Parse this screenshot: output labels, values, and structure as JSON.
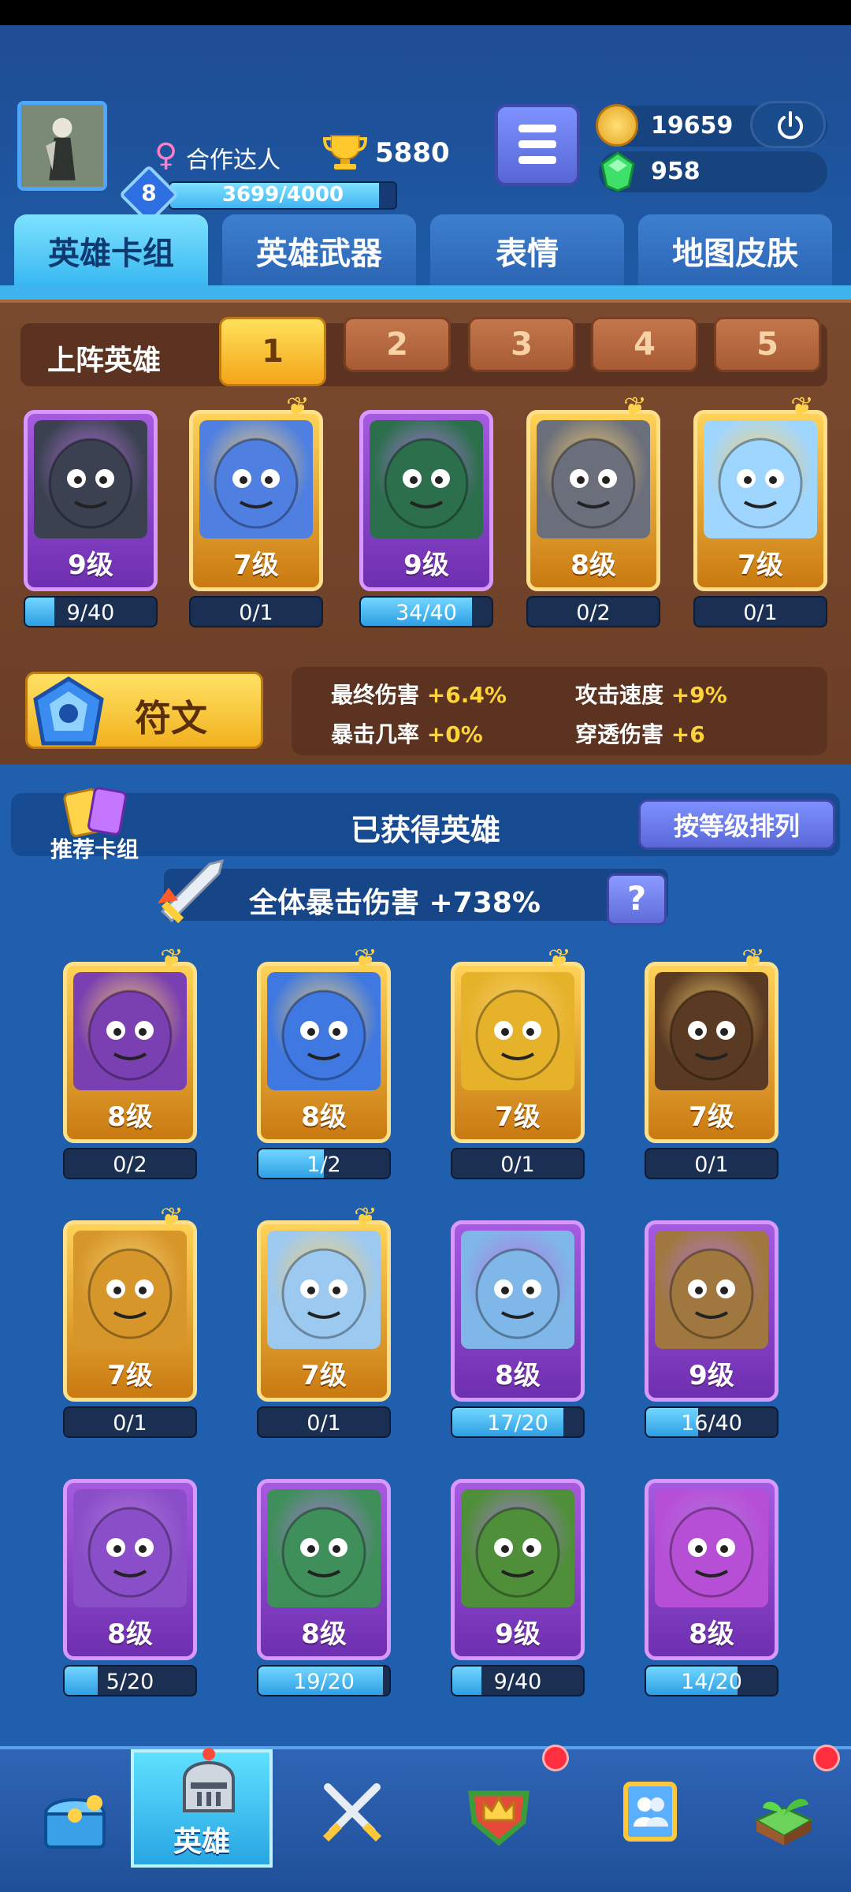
{
  "header": {
    "player_name": "合作达人",
    "trophies": "5880",
    "level": "8",
    "xp_text": "3699/4000",
    "xp_fraction": 0.925,
    "coins": "19659",
    "gems": "958"
  },
  "tabs": [
    {
      "label": "英雄卡组",
      "active": true
    },
    {
      "label": "英雄武器",
      "active": false
    },
    {
      "label": "表情",
      "active": false
    },
    {
      "label": "地图皮肤",
      "active": false
    }
  ],
  "lineup": {
    "title": "上阵英雄",
    "slots": [
      "1",
      "2",
      "3",
      "4",
      "5"
    ],
    "active_slot": 1,
    "heroes": [
      {
        "level": "9级",
        "progress": "9/40",
        "fill": 0.225,
        "frame": "purple",
        "art": "#3b4150"
      },
      {
        "level": "7级",
        "progress": "0/1",
        "fill": 0,
        "frame": "gold",
        "art": "#4f7fe0"
      },
      {
        "level": "9级",
        "progress": "34/40",
        "fill": 0.85,
        "frame": "purple",
        "art": "#2b6f4c"
      },
      {
        "level": "8级",
        "progress": "0/2",
        "fill": 0,
        "frame": "gold",
        "art": "#6b6f7c"
      },
      {
        "level": "7级",
        "progress": "0/1",
        "fill": 0,
        "frame": "gold",
        "art": "#9fd6ff"
      }
    ]
  },
  "rune": {
    "label": "符文",
    "stats": [
      {
        "name": "最终伤害",
        "value": "+6.4%"
      },
      {
        "name": "攻击速度",
        "value": "+9%"
      },
      {
        "name": "暴击几率",
        "value": "+0%"
      },
      {
        "name": "穿透伤害",
        "value": "+6"
      }
    ]
  },
  "collection": {
    "recommend_label": "推荐卡组",
    "title": "已获得英雄",
    "sort_label": "按等级排列",
    "crit_text": "全体暴击伤害 +738%",
    "help_label": "?",
    "heroes": [
      {
        "level": "8级",
        "progress": "0/2",
        "fill": 0,
        "frame": "gold",
        "art": "#7a3fb0"
      },
      {
        "level": "8级",
        "progress": "1/2",
        "fill": 0.5,
        "frame": "gold",
        "art": "#3f78e0"
      },
      {
        "level": "7级",
        "progress": "0/1",
        "fill": 0,
        "frame": "gold",
        "art": "#e6b22a"
      },
      {
        "level": "7级",
        "progress": "0/1",
        "fill": 0,
        "frame": "gold",
        "art": "#5a3a22"
      },
      {
        "level": "7级",
        "progress": "0/1",
        "fill": 0,
        "frame": "gold",
        "art": "#d6962a"
      },
      {
        "level": "7级",
        "progress": "0/1",
        "fill": 0,
        "frame": "gold",
        "art": "#9cc9f0"
      },
      {
        "level": "8级",
        "progress": "17/20",
        "fill": 0.85,
        "frame": "purple",
        "art": "#7fb7e8"
      },
      {
        "level": "9级",
        "progress": "16/40",
        "fill": 0.4,
        "frame": "purple",
        "art": "#a0783f"
      },
      {
        "level": "8级",
        "progress": "5/20",
        "fill": 0.25,
        "frame": "purple",
        "art": "#8a4fc8"
      },
      {
        "level": "8级",
        "progress": "19/20",
        "fill": 0.95,
        "frame": "purple",
        "art": "#3f8f5a"
      },
      {
        "level": "9级",
        "progress": "9/40",
        "fill": 0.225,
        "frame": "purple",
        "art": "#4f8f3a"
      },
      {
        "level": "8级",
        "progress": "14/20",
        "fill": 0.7,
        "frame": "purple",
        "art": "#b74fd6"
      }
    ]
  },
  "bottom_nav": [
    {
      "label": "",
      "icon": "treasure-chest-icon",
      "badge": false,
      "active": false
    },
    {
      "label": "英雄",
      "icon": "knight-helmet-icon",
      "badge": false,
      "active": true
    },
    {
      "label": "",
      "icon": "crossed-swords-icon",
      "badge": false,
      "active": false
    },
    {
      "label": "",
      "icon": "crown-shield-icon",
      "badge": true,
      "active": false
    },
    {
      "label": "",
      "icon": "friends-banner-icon",
      "badge": false,
      "active": false
    },
    {
      "label": "",
      "icon": "sprout-icon",
      "badge": true,
      "active": false
    }
  ],
  "colors": {
    "background": "#1f5fae",
    "wood": "#6b3e26",
    "gold": "#ffd257",
    "purple": "#a65ae0",
    "accent_cyan": "#36b7f0",
    "stat_value": "#ffd43a"
  }
}
